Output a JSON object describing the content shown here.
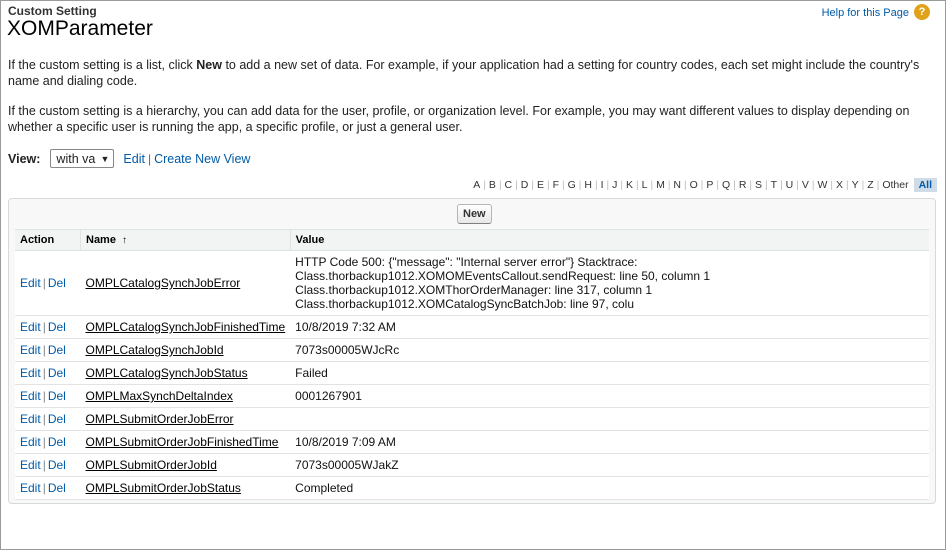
{
  "header": {
    "subtitle": "Custom Setting",
    "title": "XOMParameter",
    "help_link": "Help for this Page",
    "help_icon": "?"
  },
  "intro": {
    "p1_before": "If the custom setting is a list, click ",
    "p1_bold": "New",
    "p1_after": " to add a new set of data. For example, if your application had a setting for country codes, each set might include the country's name and dialing code.",
    "p2": "If the custom setting is a hierarchy, you can add data for the user, profile, or organization level. For example, you may want different values to display depending on whether a specific user is running the app, a specific profile, or just a general user."
  },
  "view": {
    "label": "View:",
    "selected": "with va",
    "edit": "Edit",
    "create": "Create New View"
  },
  "alphabet": [
    "A",
    "B",
    "C",
    "D",
    "E",
    "F",
    "G",
    "H",
    "I",
    "J",
    "K",
    "L",
    "M",
    "N",
    "O",
    "P",
    "Q",
    "R",
    "S",
    "T",
    "U",
    "V",
    "W",
    "X",
    "Y",
    "Z",
    "Other"
  ],
  "alphabet_all": "All",
  "table": {
    "new_button": "New",
    "headers": {
      "action": "Action",
      "name": "Name",
      "name_sort": "↑",
      "value": "Value"
    },
    "edit": "Edit",
    "del": "Del",
    "sep": "|",
    "rows": [
      {
        "name": "OMPLCatalogSynchJobError",
        "value": "HTTP Code 500: {\"message\": \"Internal server error\"} Stacktrace: Class.thorbackup1012.XOMOMEventsCallout.sendRequest: line 50, column 1 Class.thorbackup1012.XOMThorOrderManager: line 317, column 1 Class.thorbackup1012.XOMCatalogSyncBatchJob: line 97, colu"
      },
      {
        "name": "OMPLCatalogSynchJobFinishedTime",
        "value": "10/8/2019 7:32 AM"
      },
      {
        "name": "OMPLCatalogSynchJobId",
        "value": "7073s00005WJcRc"
      },
      {
        "name": "OMPLCatalogSynchJobStatus",
        "value": "Failed"
      },
      {
        "name": "OMPLMaxSynchDeltaIndex",
        "value": "0001267901"
      },
      {
        "name": "OMPLSubmitOrderJobError",
        "value": ""
      },
      {
        "name": "OMPLSubmitOrderJobFinishedTime",
        "value": "10/8/2019 7:09 AM"
      },
      {
        "name": "OMPLSubmitOrderJobId",
        "value": "7073s00005WJakZ"
      },
      {
        "name": "OMPLSubmitOrderJobStatus",
        "value": "Completed"
      }
    ]
  }
}
